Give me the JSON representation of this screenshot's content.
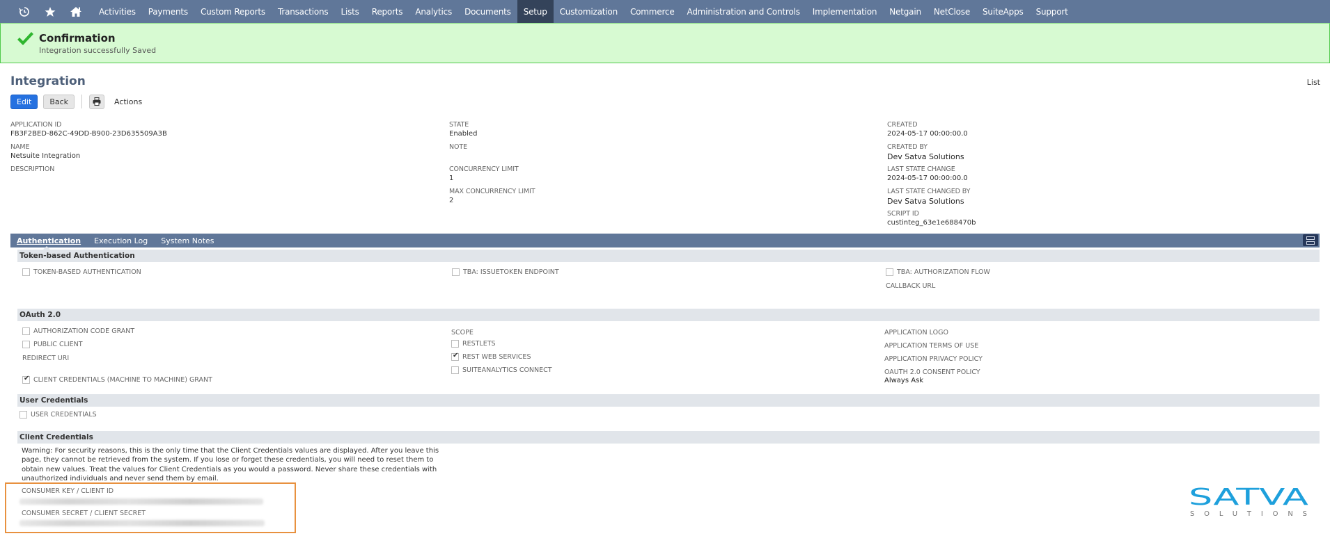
{
  "nav": {
    "icons": [
      "recent-records-icon",
      "favorites-star-icon",
      "home-icon"
    ],
    "items": [
      {
        "label": "Activities",
        "active": false
      },
      {
        "label": "Payments",
        "active": false
      },
      {
        "label": "Custom Reports",
        "active": false
      },
      {
        "label": "Transactions",
        "active": false
      },
      {
        "label": "Lists",
        "active": false
      },
      {
        "label": "Reports",
        "active": false
      },
      {
        "label": "Analytics",
        "active": false
      },
      {
        "label": "Documents",
        "active": false
      },
      {
        "label": "Setup",
        "active": true
      },
      {
        "label": "Customization",
        "active": false
      },
      {
        "label": "Commerce",
        "active": false
      },
      {
        "label": "Administration and Controls",
        "active": false
      },
      {
        "label": "Implementation",
        "active": false
      },
      {
        "label": "Netgain",
        "active": false
      },
      {
        "label": "NetClose",
        "active": false
      },
      {
        "label": "SuiteApps",
        "active": false
      },
      {
        "label": "Support",
        "active": false
      }
    ]
  },
  "confirmation": {
    "title": "Confirmation",
    "message": "Integration successfully Saved"
  },
  "page": {
    "title": "Integration",
    "list_link": "List",
    "toolbar": {
      "edit_label": "Edit",
      "back_label": "Back",
      "actions_label": "Actions"
    }
  },
  "fields": {
    "col1": [
      {
        "label": "APPLICATION ID",
        "value": "FB3F2BED-862C-49DD-B900-23D635509A3B"
      },
      {
        "label": "NAME",
        "value": "Netsuite Integration"
      },
      {
        "label": "DESCRIPTION",
        "value": ""
      }
    ],
    "col2": [
      {
        "label": "STATE",
        "value": "Enabled"
      },
      {
        "label": "NOTE",
        "value": ""
      },
      {
        "label": "CONCURRENCY LIMIT",
        "value": "1"
      },
      {
        "label": "MAX CONCURRENCY LIMIT",
        "value": "2"
      }
    ],
    "col3": [
      {
        "label": "CREATED",
        "value": "2024-05-17 00:00:00.0"
      },
      {
        "label": "CREATED BY",
        "value": "Dev Satva Solutions"
      },
      {
        "label": "LAST STATE CHANGE",
        "value": "2024-05-17 00:00:00.0"
      },
      {
        "label": "LAST STATE CHANGED BY",
        "value": "Dev Satva Solutions"
      },
      {
        "label": "SCRIPT ID",
        "value": "custinteg_63e1e688470b"
      }
    ]
  },
  "subtabs": [
    {
      "label": "Authentication",
      "active": true
    },
    {
      "label": "Execution Log",
      "active": false
    },
    {
      "label": "System Notes",
      "active": false
    }
  ],
  "tba": {
    "section_title": "Token-based Authentication",
    "token_based_auth": {
      "label": "TOKEN-BASED AUTHENTICATION",
      "checked": false
    },
    "issuetoken_endpoint": {
      "label": "TBA: ISSUETOKEN ENDPOINT",
      "checked": false
    },
    "authorization_flow": {
      "label": "TBA: AUTHORIZATION FLOW",
      "checked": false
    },
    "callback_url_label": "CALLBACK URL"
  },
  "oauth": {
    "section_title": "OAuth 2.0",
    "authorization_code_grant": {
      "label": "AUTHORIZATION CODE GRANT",
      "checked": false
    },
    "public_client": {
      "label": "PUBLIC CLIENT",
      "checked": false
    },
    "redirect_uri_label": "REDIRECT URI",
    "client_credentials_grant": {
      "label": "CLIENT CREDENTIALS (MACHINE TO MACHINE) GRANT",
      "checked": true
    },
    "scope_label": "SCOPE",
    "scopes": [
      {
        "label": "RESTLETS",
        "checked": false
      },
      {
        "label": "REST WEB SERVICES",
        "checked": true
      },
      {
        "label": "SUITEANALYTICS CONNECT",
        "checked": false
      }
    ],
    "application_logo_label": "APPLICATION LOGO",
    "terms_of_use_label": "APPLICATION TERMS OF USE",
    "privacy_policy_label": "APPLICATION PRIVACY POLICY",
    "consent_policy_label": "OAUTH 2.0 CONSENT POLICY",
    "consent_policy_value": "Always Ask"
  },
  "user_credentials": {
    "section_title": "User Credentials",
    "checkbox": {
      "label": "USER CREDENTIALS",
      "checked": false
    }
  },
  "client_credentials": {
    "section_title": "Client Credentials",
    "warning": "Warning: For security reasons, this is the only time that the Client Credentials values are displayed. After you leave this page, they cannot be retrieved from the system. If you lose or forget these credentials, you will need to reset them to obtain new values. Treat the values for Client Credentials as you would a password. Never share these credentials with unauthorized individuals and never send them by email.",
    "consumer_key_label": "CONSUMER KEY / CLIENT ID",
    "consumer_secret_label": "CONSUMER SECRET / CLIENT SECRET"
  },
  "logo": {
    "brand": "SATVA",
    "tagline": "SOLUTIONS",
    "brand_color": "#1ea0dc",
    "tagline_color": "#777777"
  },
  "colors": {
    "nav_bg": "#607799",
    "nav_active": "#34435a",
    "confirm_bg": "#d7fad2",
    "confirm_border": "#4fc94a",
    "primary_button": "#2571e0",
    "highlight_box": "#e8913f"
  }
}
